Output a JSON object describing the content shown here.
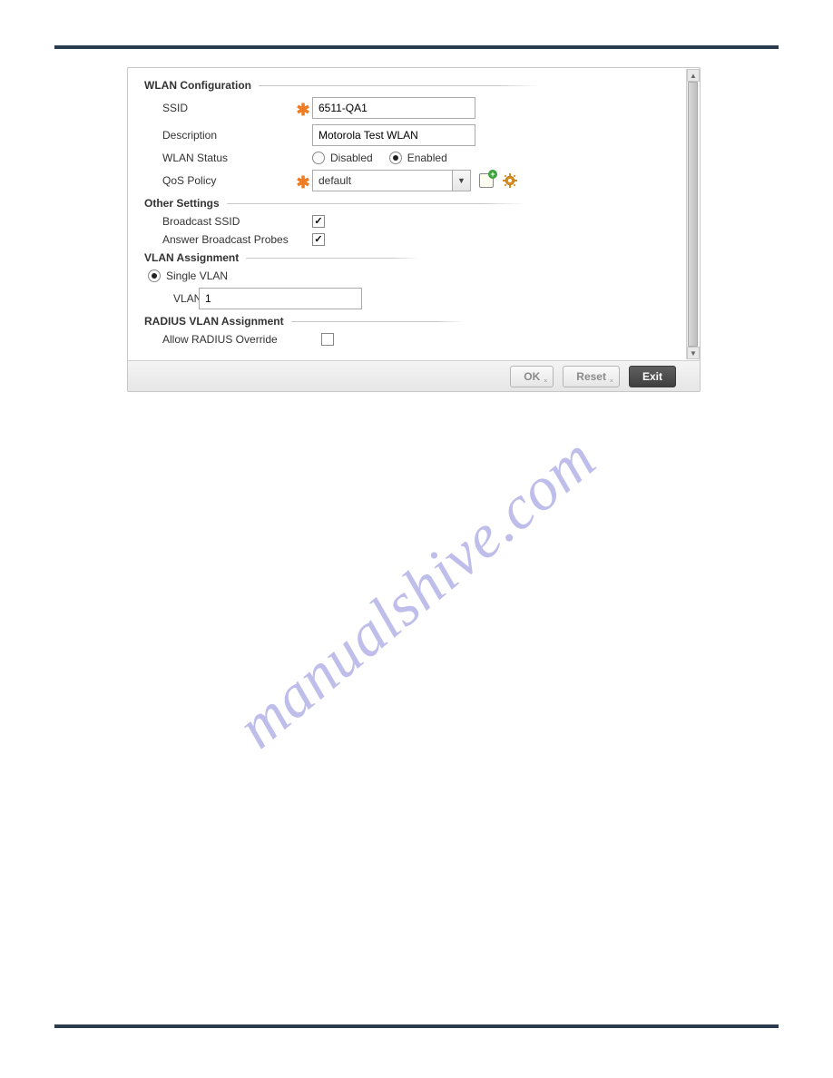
{
  "watermark": "manualshive.com",
  "wlan_config": {
    "title": "WLAN Configuration",
    "ssid_label": "SSID",
    "ssid_value": "6511-QA1",
    "desc_label": "Description",
    "desc_value": "Motorola Test WLAN",
    "status_label": "WLAN Status",
    "status_disabled": "Disabled",
    "status_enabled": "Enabled",
    "status_selected": "Enabled",
    "qos_label": "QoS Policy",
    "qos_value": "default"
  },
  "other_settings": {
    "title": "Other Settings",
    "broadcast_ssid_label": "Broadcast SSID",
    "broadcast_ssid_checked": true,
    "answer_probes_label": "Answer Broadcast Probes",
    "answer_probes_checked": true
  },
  "vlan_assign": {
    "title": "VLAN Assignment",
    "single_vlan_label": "Single VLAN",
    "single_vlan_selected": true,
    "vlan_label": "VLAN",
    "vlan_value": "1"
  },
  "radius_vlan": {
    "title": "RADIUS VLAN Assignment",
    "allow_override_label": "Allow RADIUS Override",
    "allow_override_checked": false
  },
  "footer": {
    "ok": "OK",
    "reset": "Reset",
    "exit": "Exit"
  }
}
